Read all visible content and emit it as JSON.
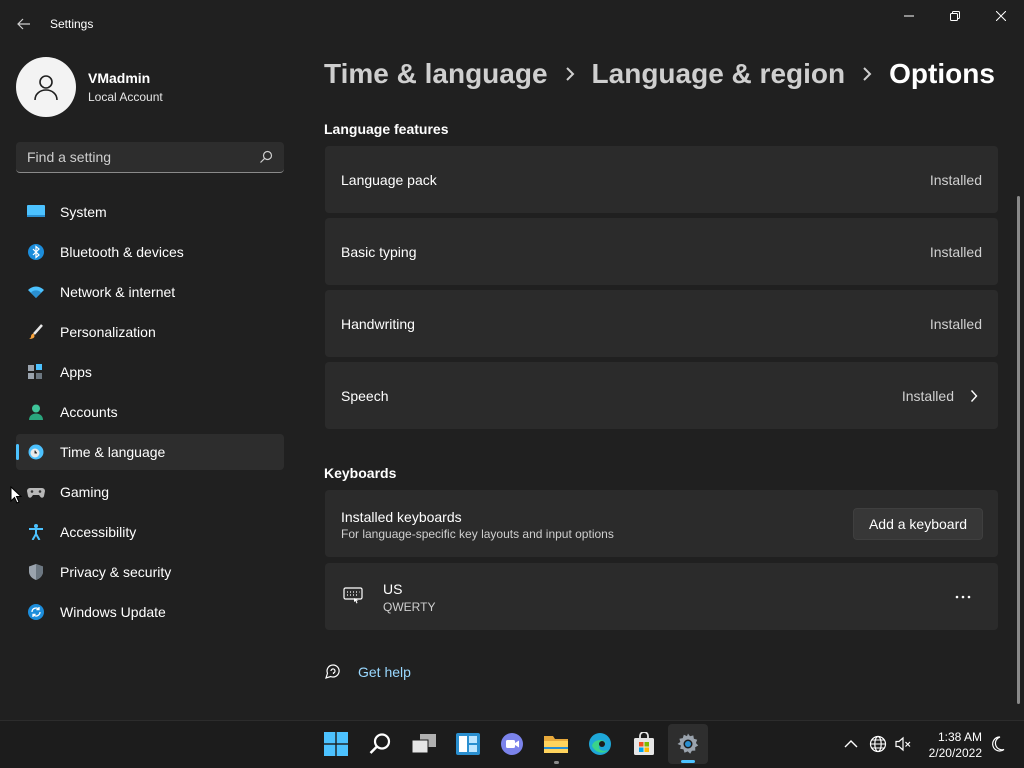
{
  "app": {
    "title": "Settings"
  },
  "profile": {
    "name": "VMadmin",
    "account_type": "Local Account"
  },
  "search": {
    "placeholder": "Find a setting"
  },
  "nav": {
    "items": [
      {
        "label": "System",
        "icon": "monitor-icon"
      },
      {
        "label": "Bluetooth & devices",
        "icon": "bluetooth-icon"
      },
      {
        "label": "Network & internet",
        "icon": "wifi-icon"
      },
      {
        "label": "Personalization",
        "icon": "brush-icon"
      },
      {
        "label": "Apps",
        "icon": "apps-icon"
      },
      {
        "label": "Accounts",
        "icon": "person-icon"
      },
      {
        "label": "Time & language",
        "icon": "globe-clock-icon",
        "selected": true
      },
      {
        "label": "Gaming",
        "icon": "gamepad-icon"
      },
      {
        "label": "Accessibility",
        "icon": "accessibility-icon"
      },
      {
        "label": "Privacy & security",
        "icon": "shield-icon"
      },
      {
        "label": "Windows Update",
        "icon": "update-icon"
      }
    ]
  },
  "breadcrumb": {
    "parts": [
      "Time & language",
      "Language & region"
    ],
    "current": "Options"
  },
  "language_features": {
    "title": "Language features",
    "items": [
      {
        "label": "Language pack",
        "status": "Installed"
      },
      {
        "label": "Basic typing",
        "status": "Installed"
      },
      {
        "label": "Handwriting",
        "status": "Installed"
      },
      {
        "label": "Speech",
        "status": "Installed",
        "expandable": true
      }
    ]
  },
  "keyboards": {
    "title": "Keyboards",
    "installed_label": "Installed keyboards",
    "installed_desc": "For language-specific key layouts and input options",
    "add_button": "Add a keyboard",
    "list": [
      {
        "name": "US",
        "layout": "QWERTY"
      }
    ]
  },
  "help": {
    "label": "Get help"
  },
  "taskbar": {
    "time": "1:38 AM",
    "date": "2/20/2022"
  },
  "colors": {
    "accent": "#4cc2ff",
    "background": "#202020",
    "card": "#2b2b2b",
    "link": "#99d8ff"
  }
}
